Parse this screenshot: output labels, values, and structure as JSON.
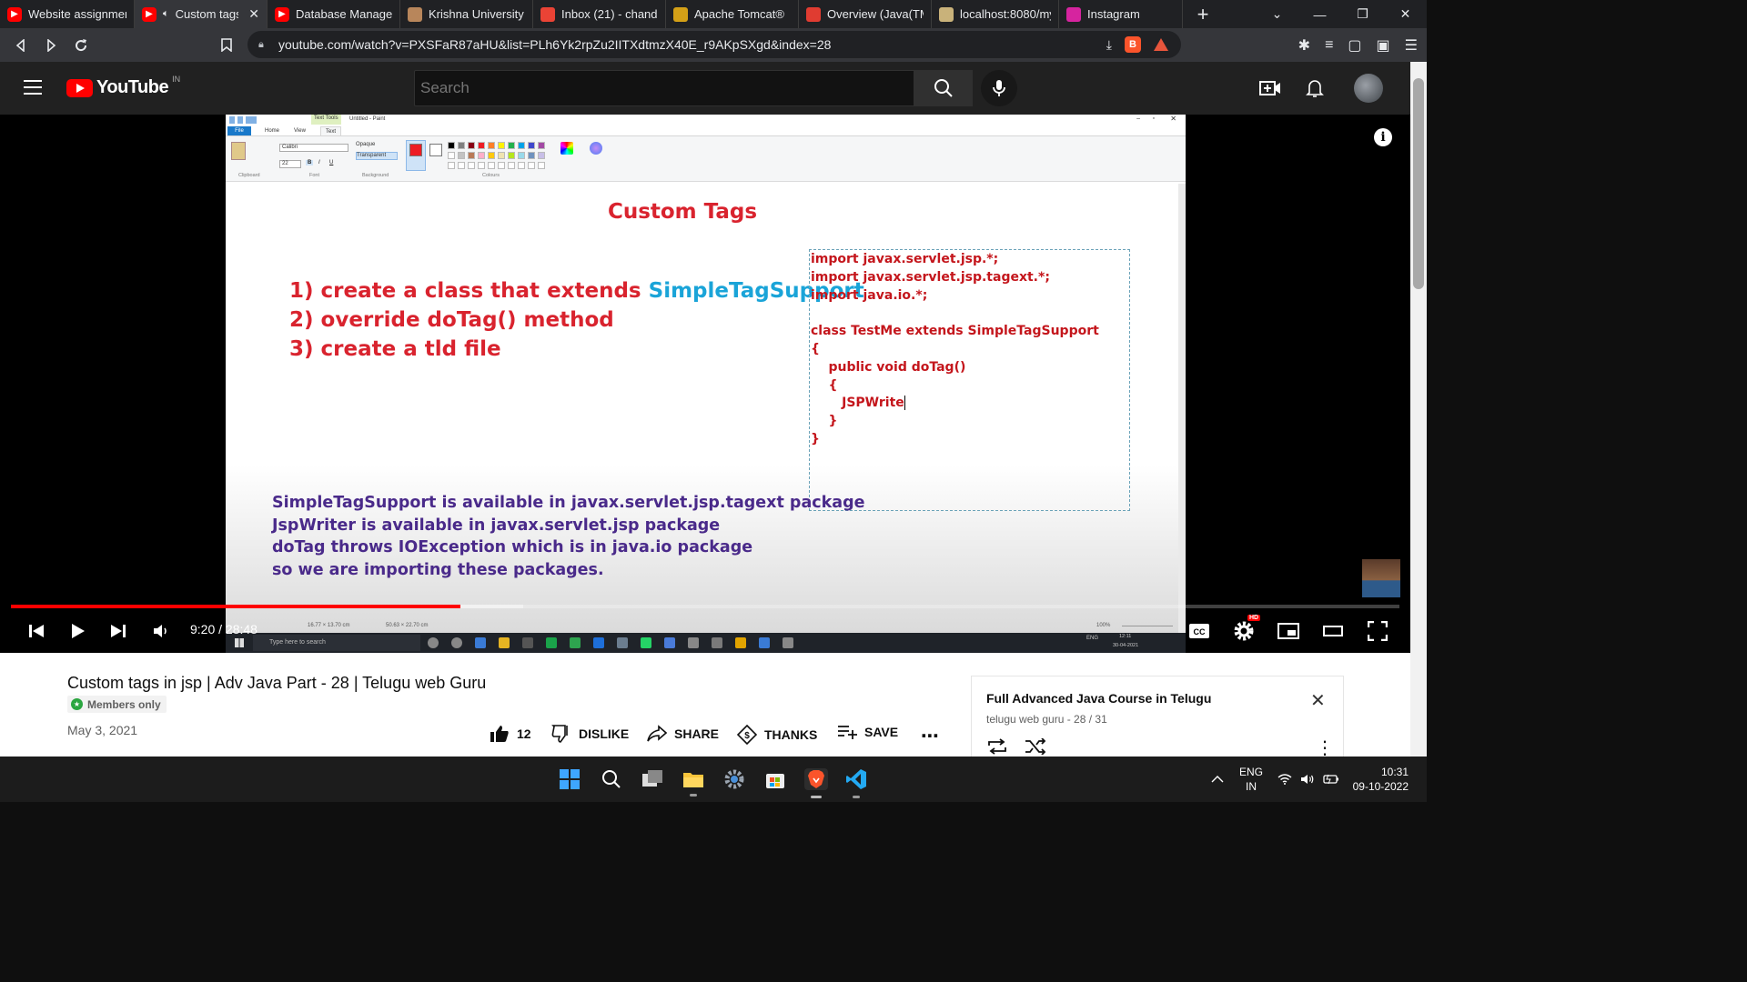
{
  "browser": {
    "tabs": [
      {
        "label": "Website assignmen",
        "icon": "youtube-icon"
      },
      {
        "label": "Custom tags",
        "icon": "youtube-icon",
        "active": true
      },
      {
        "label": "Database Managem",
        "icon": "youtube-icon"
      },
      {
        "label": "Krishna University",
        "icon": "university-icon"
      },
      {
        "label": "Inbox (21) - chandu",
        "icon": "gmail-icon"
      },
      {
        "label": "Apache Tomcat®",
        "icon": "tomcat-icon"
      },
      {
        "label": "Overview (Java(TM)",
        "icon": "oracle-icon"
      },
      {
        "label": "localhost:8080/myp",
        "icon": "page-icon"
      },
      {
        "label": "Instagram",
        "icon": "instagram-icon"
      }
    ],
    "url": "youtube.com/watch?v=PXSFaR87aHU&list=PLh6Yk2rpZu2IITXdtmzX40E_r9AKpSXgd&index=28"
  },
  "youtube": {
    "logo_text": "YouTube",
    "country": "IN",
    "search_placeholder": "Search"
  },
  "paint": {
    "window_title": "Untitled - Paint",
    "context_tab": "Text Tools",
    "tabs": [
      "File",
      "Home",
      "View",
      "Text"
    ],
    "font_name": "Calibri",
    "font_size": "22",
    "groups": [
      "Clipboard",
      "Font",
      "Background",
      "Colours"
    ],
    "background_opts": [
      "Opaque",
      "Transparent"
    ],
    "status_left": "16.77 × 13.70 cm",
    "status_mid": "50.63 × 22.70 cm",
    "zoom": "100%",
    "taskbar_search": "Type here to search",
    "clock_time": "12:11",
    "clock_date": "30-04-2021",
    "lang": "ENG",
    "palette": [
      "#000000",
      "#7f7f7f",
      "#880015",
      "#ed1c24",
      "#ff7f27",
      "#fff200",
      "#22b14c",
      "#00a2e8",
      "#3f48cc",
      "#a349a4",
      "#ffffff",
      "#c3c3c3",
      "#b97a57",
      "#ffaec9",
      "#ffc90e",
      "#efe4b0",
      "#b5e61d",
      "#99d9ea",
      "#7092be",
      "#c8bfe7"
    ]
  },
  "slide": {
    "title": "Custom Tags",
    "steps": [
      {
        "prefix": "1) create a class that extends ",
        "highlight": "SimpleTagSupport"
      },
      {
        "prefix": "2) override doTag() method",
        "highlight": ""
      },
      {
        "prefix": "3) create a tld file",
        "highlight": ""
      }
    ],
    "code_lines": [
      "import javax.servlet.jsp.*;",
      "import javax.servlet.jsp.tagext.*;",
      "import java.io.*;",
      "",
      "class TestMe extends SimpleTagSupport",
      "{",
      "    public void doTag()",
      "    {",
      "       JSPWrite",
      "    }",
      "}"
    ],
    "notes": [
      "SimpleTagSupport is available in javax.servlet.jsp.tagext package",
      "JspWriter is available in javax.servlet.jsp package",
      "doTag throws IOException which is in java.io package",
      "so we are importing these packages."
    ]
  },
  "player": {
    "time": "9:20 / 28:48",
    "played_fraction": 0.324,
    "loaded_fraction": 0.369,
    "hd_badge": "HD"
  },
  "video_info": {
    "title": "Custom tags in jsp | Adv Java Part - 28 | Telugu web Guru",
    "members_badge": "Members only",
    "date": "May 3, 2021",
    "likes": "12",
    "dislike_label": "DISLIKE",
    "share_label": "SHARE",
    "thanks_label": "THANKS",
    "save_label": "SAVE"
  },
  "playlist": {
    "title": "Full Advanced Java Course in Telugu",
    "subtitle": "telugu web guru - 28 / 31"
  },
  "taskbar": {
    "lang_top": "ENG",
    "lang_bottom": "IN",
    "time": "10:31",
    "date": "09-10-2022"
  }
}
